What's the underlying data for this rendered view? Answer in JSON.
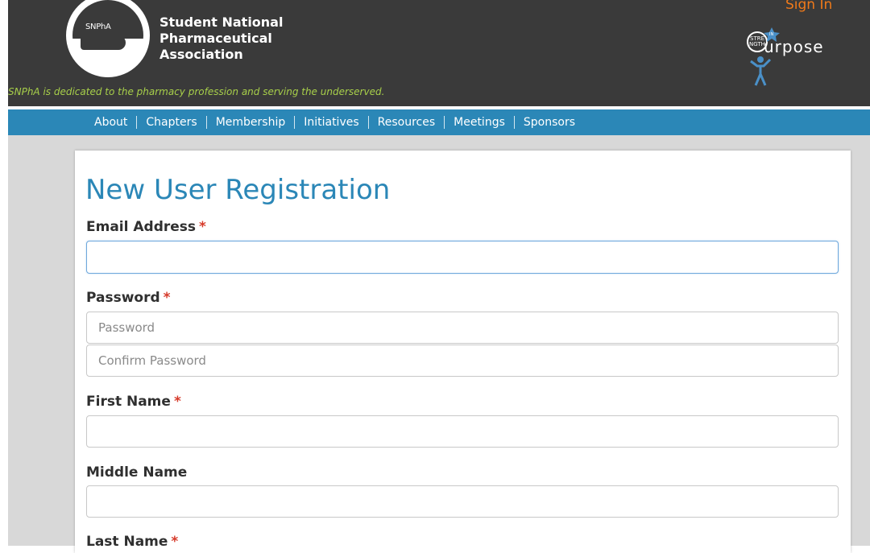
{
  "header": {
    "logo_text": "SNPhA",
    "org_name": [
      "Student National",
      "Pharmaceutical",
      "Association"
    ],
    "tagline": "SNPhA is dedicated to the pharmacy profession and serving the underserved.",
    "signin_label": "Sign In",
    "purpose_logo_text": "urpose"
  },
  "nav": {
    "items": [
      "About",
      "Chapters",
      "Membership",
      "Initiatives",
      "Resources",
      "Meetings",
      "Sponsors"
    ]
  },
  "form": {
    "title": "New User Registration",
    "required_marker": "*",
    "email_label": "Email Address",
    "email_value": "",
    "password_label": "Password",
    "password_placeholder": "Password",
    "confirm_password_placeholder": "Confirm Password",
    "first_name_label": "First Name",
    "first_name_value": "",
    "middle_name_label": "Middle Name",
    "middle_name_value": "",
    "last_name_label": "Last Name"
  },
  "colors": {
    "header_bg": "#3a3a3a",
    "nav_bg": "#2b87b7",
    "tagline": "#a8d04a",
    "signin": "#f07a1a",
    "title": "#2b87b7",
    "required": "#d63a2a"
  }
}
